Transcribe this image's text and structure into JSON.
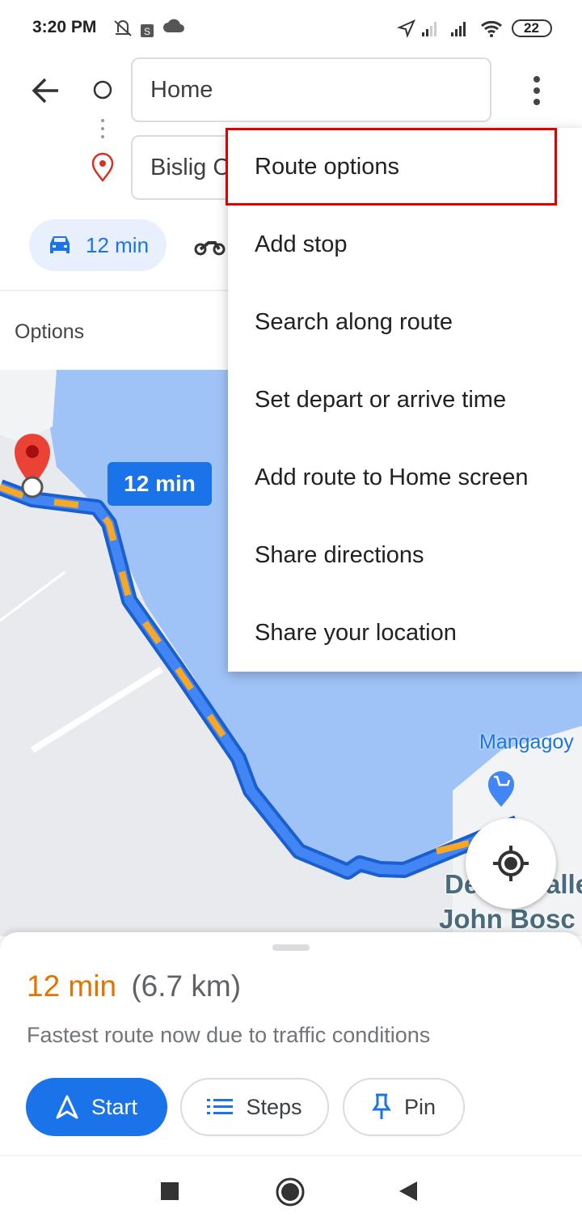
{
  "status_bar": {
    "time": "3:20 PM",
    "battery": "22"
  },
  "header": {
    "origin": "Home",
    "destination": "Bislig C"
  },
  "modes": [
    {
      "icon": "car-icon",
      "label": "12 min",
      "selected": true
    },
    {
      "icon": "motorcycle-icon"
    }
  ],
  "options_label": "Options",
  "menu": {
    "items": [
      "Route options",
      "Add stop",
      "Search along route",
      "Set depart or arrive time",
      "Add route to Home screen",
      "Share directions",
      "Share your location"
    ],
    "highlighted": "Route options",
    "highlight_color": "#e00000"
  },
  "map": {
    "route_badge": "12 min",
    "place_label": "Mangagoy",
    "label_fragments": [
      "De",
      "alle",
      "John Bosc"
    ],
    "route_color": "#4285f4",
    "traffic_color": "#f9a825",
    "water_color": "#a0c3f7"
  },
  "summary": {
    "duration": "12 min",
    "distance": "(6.7 km)",
    "description": "Fastest route now due to traffic conditions",
    "duration_color": "#e37400"
  },
  "actions": {
    "start": "Start",
    "steps": "Steps",
    "pin": "Pin"
  }
}
